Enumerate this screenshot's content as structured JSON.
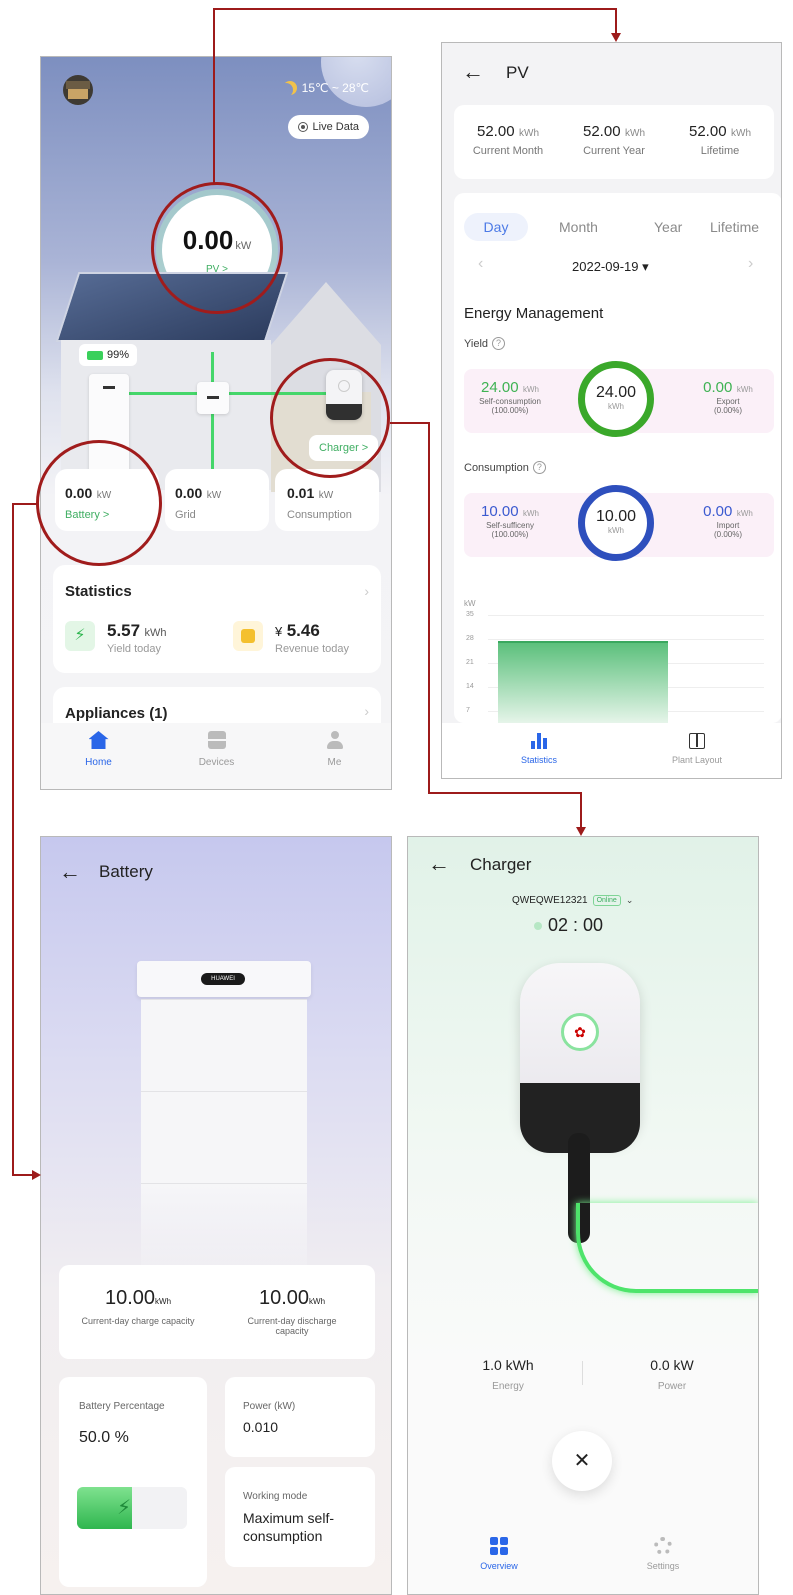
{
  "home": {
    "weather": "15℃ ~ 28℃",
    "live_data_label": "Live Data",
    "pv_value": "0.00",
    "pv_unit": "kW",
    "pv_link": "PV >",
    "battery_soc": "99%",
    "charger_link": "Charger >",
    "energy_cards": [
      {
        "value": "0.00",
        "unit": "kW",
        "label": "Battery >"
      },
      {
        "value": "0.00",
        "unit": "kW",
        "label": "Grid"
      },
      {
        "value": "0.01",
        "unit": "kW",
        "label": "Consumption"
      }
    ],
    "statistics": {
      "title": "Statistics",
      "yield_value": "5.57",
      "yield_unit": "kWh",
      "yield_label": "Yield today",
      "revenue_currency": "¥",
      "revenue_value": "5.46",
      "revenue_label": "Revenue today"
    },
    "appliances_title": "Appliances (1)",
    "nav": [
      {
        "label": "Home",
        "icon": "home-icon"
      },
      {
        "label": "Devices",
        "icon": "devices-icon"
      },
      {
        "label": "Me",
        "icon": "person-icon"
      }
    ]
  },
  "pv": {
    "title": "PV",
    "stats": [
      {
        "value": "52.00",
        "unit": "kWh",
        "label": "Current Month"
      },
      {
        "value": "52.00",
        "unit": "kWh",
        "label": "Current Year"
      },
      {
        "value": "52.00",
        "unit": "kWh",
        "label": "Lifetime"
      }
    ],
    "tabs": [
      "Day",
      "Month",
      "Year",
      "Lifetime"
    ],
    "date": "2022-09-19 ▾",
    "section_title": "Energy Management",
    "yield": {
      "label": "Yield",
      "left_value": "24.00",
      "left_unit": "kWh",
      "left_label": "Self-consumption",
      "left_pct": "(100.00%)",
      "ring_value": "24.00",
      "ring_unit": "kWh",
      "right_value": "0.00",
      "right_unit": "kWh",
      "right_label": "Export",
      "right_pct": "(0.00%)"
    },
    "consumption": {
      "label": "Consumption",
      "left_value": "10.00",
      "left_unit": "kWh",
      "left_label": "Self-sufficeny",
      "left_pct": "(100.00%)",
      "ring_value": "10.00",
      "ring_unit": "kWh",
      "right_value": "0.00",
      "right_unit": "kWh",
      "right_label": "Import",
      "right_pct": "(0.00%)"
    },
    "chart": {
      "unit": "kW",
      "ticks": [
        "35",
        "28",
        "21",
        "14",
        "7",
        "0"
      ]
    },
    "nav": [
      {
        "label": "Statistics",
        "icon": "bar-chart-icon"
      },
      {
        "label": "Plant Layout",
        "icon": "layout-icon"
      }
    ]
  },
  "battery": {
    "title": "Battery",
    "charge_value": "10.00",
    "charge_unit": "kWh",
    "charge_label": "Current-day charge capacity",
    "discharge_value": "10.00",
    "discharge_unit": "kWh",
    "discharge_label": "Current-day discharge capacity",
    "percentage_label": "Battery Percentage",
    "percentage_value": "50.0 %",
    "power_label": "Power (kW)",
    "power_value": "0.010",
    "mode_label": "Working mode",
    "mode_value": "Maximum self-consumption",
    "brand": "HUAWEI"
  },
  "charger": {
    "title": "Charger",
    "serial": "QWEQWE12321",
    "status_badge": "Online",
    "timer": "02 : 00",
    "energy_value": "1.0 kWh",
    "energy_label": "Energy",
    "power_value": "0.0 kW",
    "power_label": "Power",
    "nav": [
      {
        "label": "Overview",
        "icon": "overview-icon"
      },
      {
        "label": "Settings",
        "icon": "gear-icon"
      }
    ]
  }
}
